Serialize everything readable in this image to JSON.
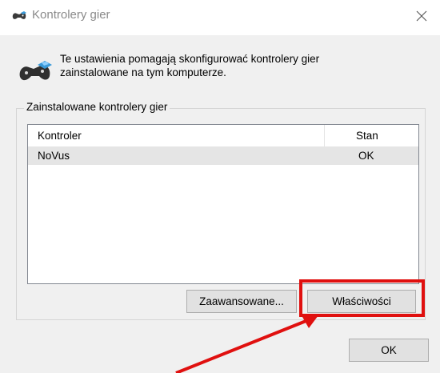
{
  "window": {
    "title": "Kontrolery gier",
    "title_icon": "gamepad-icon",
    "close_icon": "close-icon"
  },
  "intro": {
    "icon": "gamepad-icon",
    "text_line1": "Te ustawienia pomagają skonfigurować kontrolery gier",
    "text_line2": "zainstalowane na tym komputerze."
  },
  "group": {
    "legend": "Zainstalowane kontrolery gier",
    "columns": [
      "Kontroler",
      "Stan"
    ],
    "rows": [
      {
        "name": "NoVus",
        "status": "OK"
      }
    ]
  },
  "buttons": {
    "advanced": "Zaawansowane...",
    "properties": "Właściwości",
    "ok": "OK"
  },
  "annotation": {
    "color": "#e0100f"
  }
}
